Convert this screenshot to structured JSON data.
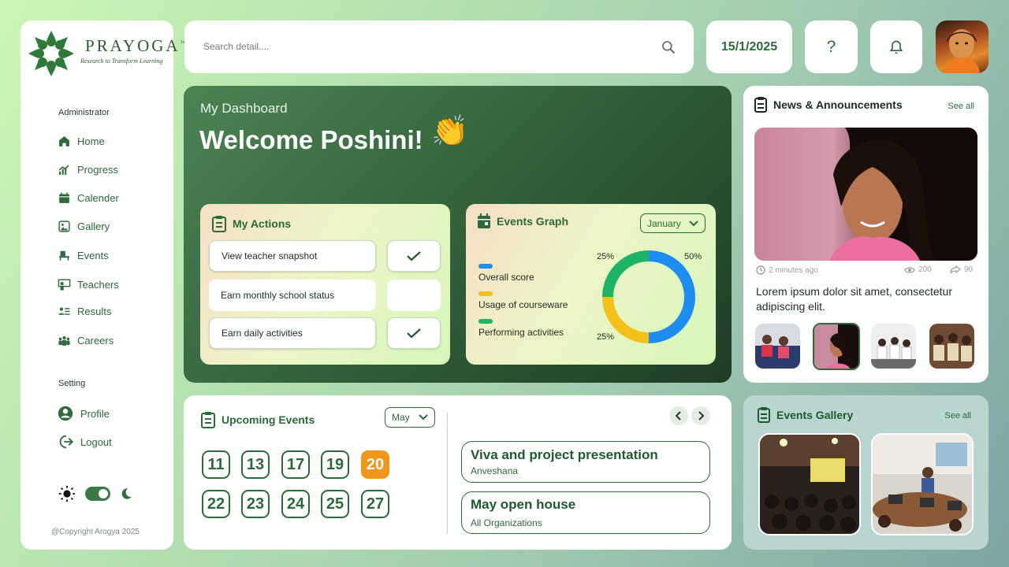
{
  "brand": {
    "name": "PRAYOGA",
    "trademark": "™",
    "tagline": "Research to Transform Learning"
  },
  "sidebar": {
    "admin_label": "Administrator",
    "items": [
      {
        "label": "Home",
        "icon": "home-icon"
      },
      {
        "label": "Progress",
        "icon": "progress-icon"
      },
      {
        "label": "Calender",
        "icon": "calendar-icon"
      },
      {
        "label": "Gallery",
        "icon": "gallery-icon"
      },
      {
        "label": "Events",
        "icon": "events-icon"
      },
      {
        "label": "Teachers",
        "icon": "teachers-icon"
      },
      {
        "label": "Results",
        "icon": "results-icon"
      },
      {
        "label": "Careers",
        "icon": "careers-icon"
      }
    ],
    "setting_label": "Setting",
    "settings": [
      {
        "label": "Profile",
        "icon": "profile-icon"
      },
      {
        "label": "Logout",
        "icon": "logout-icon"
      }
    ],
    "copyright": "@Copyright Arogya 2025"
  },
  "topbar": {
    "search_placeholder": "Search detail....",
    "date": "15/1/2025",
    "help": "?"
  },
  "dashboard": {
    "subtitle": "My Dashboard",
    "welcome": "Welcome Poshini!",
    "emoji": "👏"
  },
  "actions": {
    "title": "My Actions",
    "items": [
      {
        "label": "View teacher snapshot",
        "done": true
      },
      {
        "label": "Earn monthly school status",
        "done": false
      },
      {
        "label": "Earn daily activities",
        "done": true
      }
    ]
  },
  "events_graph": {
    "title": "Events Graph",
    "month": "January",
    "legend": [
      {
        "label": "Overall score",
        "color": "#1e8cf0"
      },
      {
        "label": "Usage of courseware",
        "color": "#f2c21b"
      },
      {
        "label": "Performing activities",
        "color": "#1fb366"
      }
    ],
    "percent_labels": {
      "top_left": "25%",
      "top_right": "50%",
      "bottom_left": "25%"
    }
  },
  "chart_data": {
    "type": "pie",
    "categories": [
      "Overall score",
      "Usage of courseware",
      "Performing activities"
    ],
    "values": [
      50,
      25,
      25
    ],
    "colors": [
      "#1e8cf0",
      "#f2c21b",
      "#1fb366"
    ],
    "title": "Events Graph"
  },
  "news": {
    "title": "News & Announcements",
    "see_all": "See all",
    "time": "2 minutes ago",
    "views": "200",
    "shares": "90",
    "text": "Lorem ipsum dolor sit amet, consectetur adipiscing elit."
  },
  "upcoming": {
    "title": "Upcoming Events",
    "month": "May",
    "days_row1": [
      "11",
      "13",
      "17",
      "19",
      "20"
    ],
    "days_row2": [
      "22",
      "23",
      "24",
      "25",
      "27"
    ],
    "active_day": "20",
    "events": [
      {
        "title": "Viva and project presentation",
        "subtitle": "Anveshana"
      },
      {
        "title": "May open house",
        "subtitle": "All Organizations"
      }
    ]
  },
  "gallery": {
    "title": "Events Gallery",
    "see_all": "See all"
  },
  "colors": {
    "primary": "#2d6a3a",
    "accent": "#f0961a",
    "dashboard_dark": "#1f3d26"
  }
}
